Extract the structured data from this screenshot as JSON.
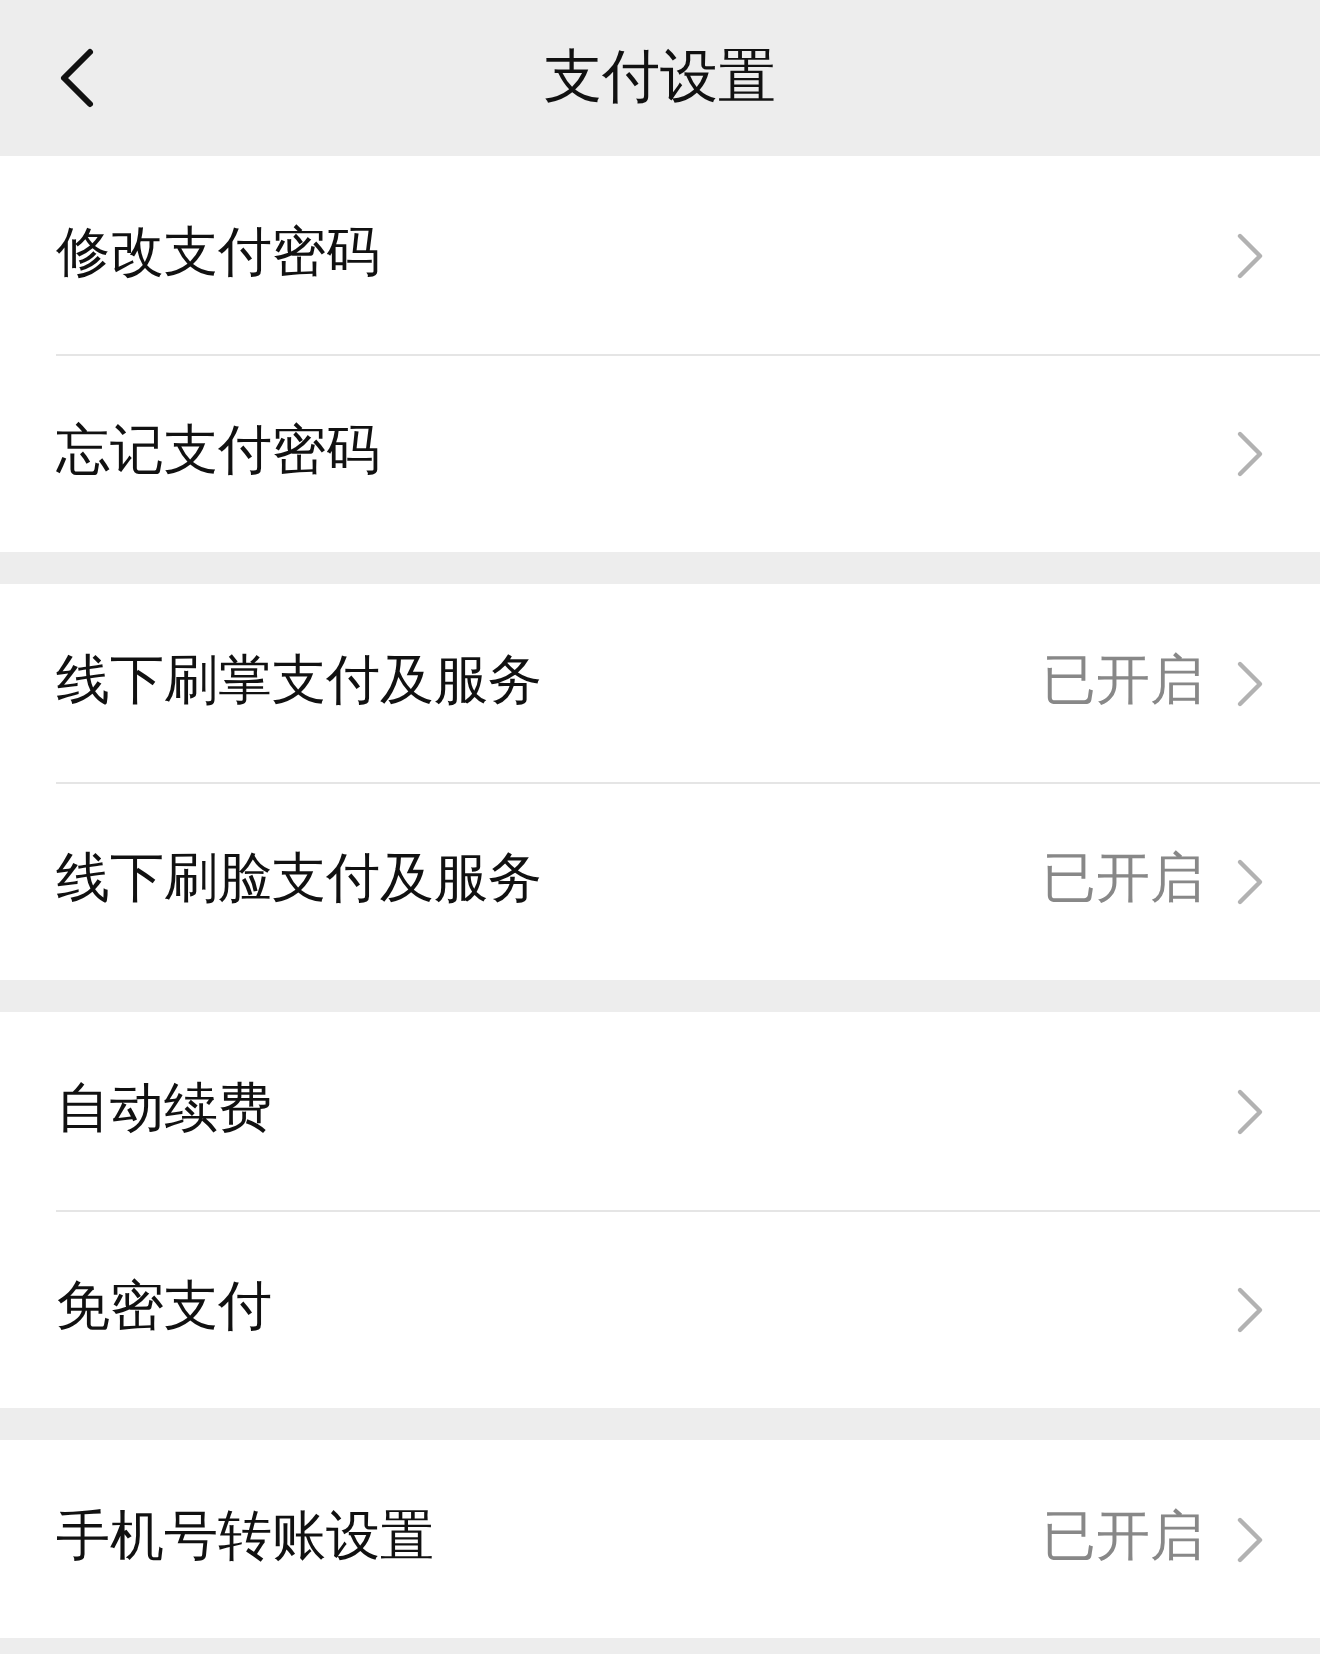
{
  "header": {
    "title": "支付设置"
  },
  "groups": [
    {
      "items": [
        {
          "label": "修改支付密码"
        },
        {
          "label": "忘记支付密码"
        }
      ]
    },
    {
      "items": [
        {
          "label": "线下刷掌支付及服务",
          "value": "已开启"
        },
        {
          "label": "线下刷脸支付及服务",
          "value": "已开启"
        }
      ]
    },
    {
      "items": [
        {
          "label": "自动续费"
        },
        {
          "label": "免密支付"
        }
      ]
    },
    {
      "items": [
        {
          "label": "手机号转账设置",
          "value": "已开启"
        }
      ]
    }
  ]
}
